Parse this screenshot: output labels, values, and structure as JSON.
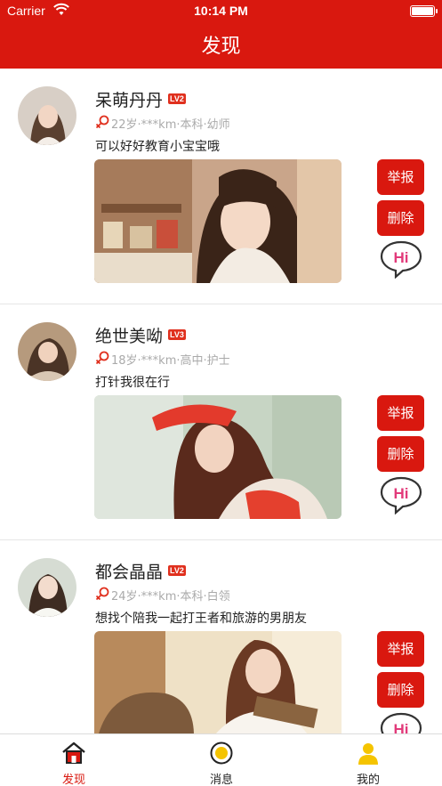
{
  "status_bar": {
    "carrier": "Carrier",
    "time": "10:14 PM"
  },
  "nav": {
    "title": "发现"
  },
  "colors": {
    "brand_red": "#d9180f",
    "meta_gray": "#aaaaaa",
    "badge_red": "#e0301e"
  },
  "feed": {
    "action_report_label": "举报",
    "action_delete_label": "删除",
    "greet_icon": "hi-bubble-icon",
    "cards": [
      {
        "name": "呆萌丹丹",
        "level": "LV2",
        "meta": "22岁·***km·本科·幼师",
        "bio": "可以好好教育小宝宝哦"
      },
      {
        "name": "绝世美呦",
        "level": "LV3",
        "meta": "18岁·***km·高中·护士",
        "bio": "打针我很在行"
      },
      {
        "name": "都会晶晶",
        "level": "LV2",
        "meta": "24岁·***km·本科·白领",
        "bio": "想找个陪我一起打王者和旅游的男朋友"
      }
    ]
  },
  "tab_bar": {
    "items": [
      {
        "label": "发现",
        "icon": "house-icon",
        "active": true
      },
      {
        "label": "消息",
        "icon": "message-icon",
        "active": false
      },
      {
        "label": "我的",
        "icon": "profile-icon",
        "active": false
      }
    ]
  }
}
